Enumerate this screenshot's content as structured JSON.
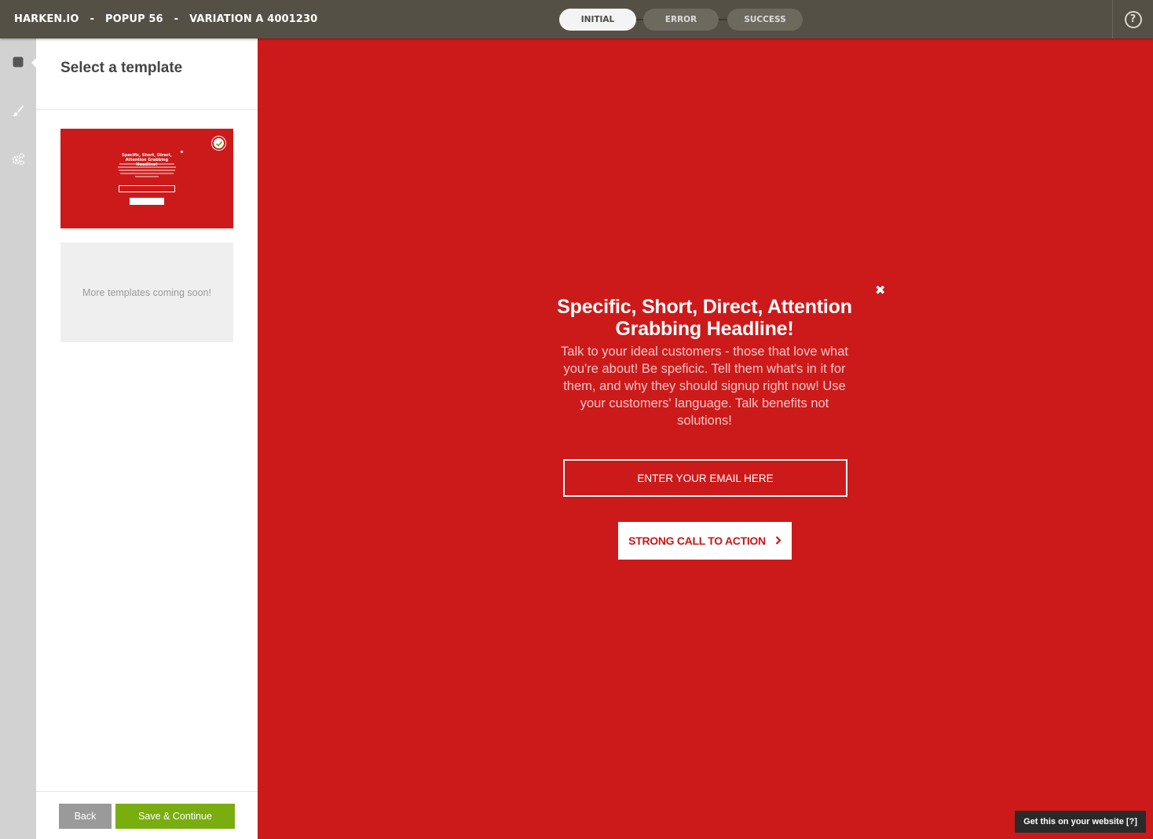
{
  "header": {
    "breadcrumb": [
      "HARKEN.IO",
      "POPUP 56",
      "VARIATION A 4001230"
    ],
    "separator": "-",
    "states": [
      {
        "label": "INITIAL",
        "active": true
      },
      {
        "label": "ERROR",
        "active": false
      },
      {
        "label": "SUCCESS",
        "active": false
      }
    ],
    "help_label": "?"
  },
  "rail": {
    "items": [
      {
        "icon": "template-icon",
        "active": true
      },
      {
        "icon": "brush-icon",
        "active": false
      },
      {
        "icon": "gears-icon",
        "active": false
      }
    ]
  },
  "panel": {
    "title": "Select a template",
    "more_templates": "More templates coming soon!",
    "back_label": "Back",
    "save_label": "Save & Continue"
  },
  "popup": {
    "close_label": "✖",
    "headline": "Specific, Short, Direct, Attention Grabbing Headline!",
    "body": "Talk to your ideal customers - those that love what you're about! Be speficic. Tell them what's in it for them, and why they should signup right now! Use your customers' language. Talk benefits not solutions!",
    "email_placeholder": "ENTER YOUR EMAIL HERE",
    "cta_label": "STRONG CALL TO ACTION",
    "background_color": "#cc1a1a"
  },
  "promo": {
    "label": "Get this on your website [?]"
  }
}
